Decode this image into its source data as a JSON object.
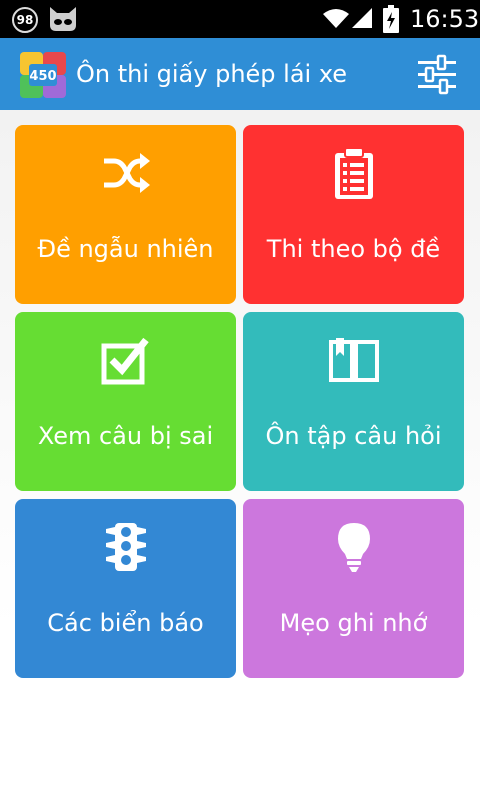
{
  "status_bar": {
    "notification_count": "98",
    "time": "16:53"
  },
  "action_bar": {
    "logo_text": "450",
    "title": "Ôn thi giấy phép lái xe"
  },
  "menu": [
    {
      "label": "Đề ngẫu nhiên",
      "icon": "shuffle-icon",
      "color": "#ff9f00"
    },
    {
      "label": "Thi theo bộ đề",
      "icon": "clipboard-icon",
      "color": "#ff3131"
    },
    {
      "label": "Xem câu bị sai",
      "icon": "checkbox-icon",
      "color": "#66dd33"
    },
    {
      "label": "Ôn tập câu hỏi",
      "icon": "book-icon",
      "color": "#33bbbb"
    },
    {
      "label": "Các biển báo",
      "icon": "traffic-light-icon",
      "color": "#3388d4"
    },
    {
      "label": "Mẹo ghi nhớ",
      "icon": "lightbulb-icon",
      "color": "#cc77dd"
    }
  ]
}
